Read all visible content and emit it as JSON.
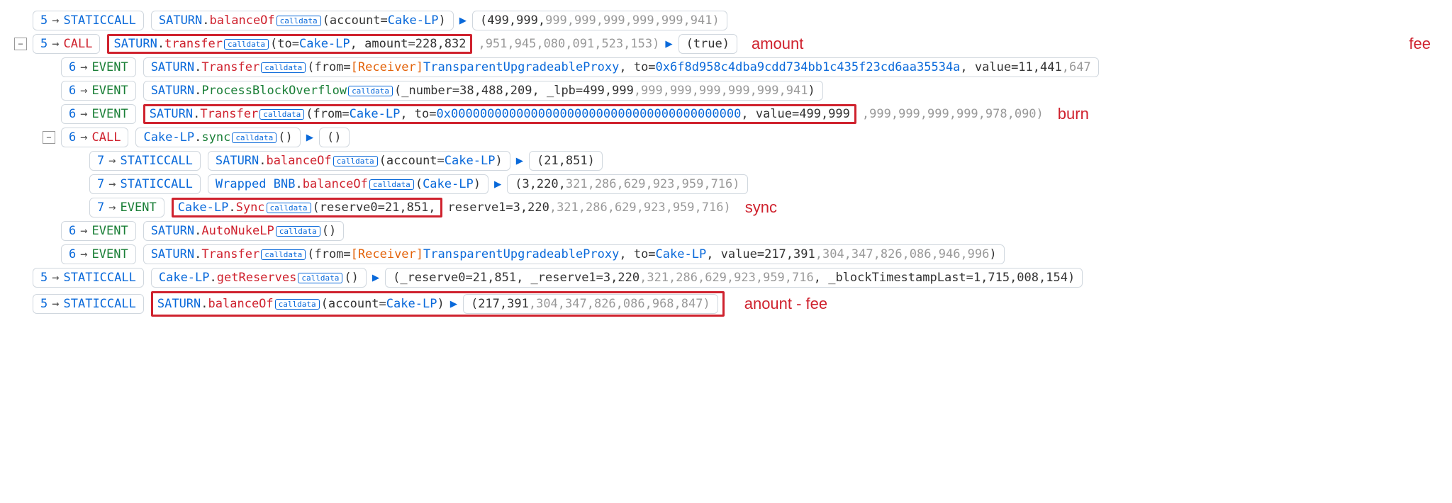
{
  "rows": [
    {
      "indent": 0,
      "toggle": null,
      "depth": "5",
      "type": "STATICCALL",
      "contract": "SATURN",
      "method": "balanceOf",
      "methodClass": "method-r",
      "args": [
        {
          "k": "account",
          "v": "Cake-LP",
          "cls": "val-blue"
        }
      ],
      "retDark": "(499,999,",
      "retLight": "999,999,999,999,999,941)",
      "ret": true
    },
    {
      "indent": 0,
      "toggle": "−",
      "depth": "5",
      "type": "CALL",
      "redbox": true,
      "contract": "SATURN",
      "method": "transfer",
      "methodClass": "method-r",
      "args": [
        {
          "k": "to",
          "v": "Cake-LP",
          "cls": "val-blue"
        },
        {
          "k": "amount",
          "v": "228,832",
          "cls": "num-dark"
        }
      ],
      "tailLight": ",951,945,080,091,523,153)",
      "retDark": "(true)",
      "ret": true,
      "ann": "amount",
      "annFar": "fee"
    },
    {
      "indent": 1,
      "toggle": null,
      "depth": "6",
      "type": "EVENT",
      "contract": "SATURN",
      "method": "Transfer",
      "methodClass": "method-r",
      "rawArgs": "(from=<o>[Receiver]</o><b>TransparentUpgradeableProxy</b>, to=<b>0x6f8d958c4dba9cdd734bb1c435f23cd6aa35534a</b>, value=11,441<l>,647</l>"
    },
    {
      "indent": 1,
      "toggle": null,
      "depth": "6",
      "type": "EVENT",
      "contract": "SATURN",
      "method": "ProcessBlockOverflow",
      "methodClass": "method-g",
      "rawArgs": "(_number=38,488,209, _lpb=499,999<l>,999,999,999,999,999,941</l>)"
    },
    {
      "indent": 1,
      "toggle": null,
      "depth": "6",
      "type": "EVENT",
      "redboxBody": true,
      "contract": "SATURN",
      "method": "Transfer",
      "methodClass": "method-r",
      "rawArgs": "(from=<b>Cake-LP</b>, to=<b>0x0000000000000000000000000000000000000000</b>, value=499,999",
      "tailLight": ",999,999,999,999,978,090)",
      "ann": "burn",
      "annShift": true
    },
    {
      "indent": 1,
      "toggle": "−",
      "depth": "6",
      "type": "CALL",
      "contract": "Cake-LP",
      "method": "sync",
      "methodClass": "method-g",
      "args": [],
      "retDark": "()",
      "ret": true
    },
    {
      "indent": 2,
      "toggle": null,
      "depth": "7",
      "type": "STATICCALL",
      "contract": "SATURN",
      "method": "balanceOf",
      "methodClass": "method-r",
      "args": [
        {
          "k": "account",
          "v": "Cake-LP",
          "cls": "val-blue"
        }
      ],
      "retDark": "(21,851)",
      "ret": true
    },
    {
      "indent": 2,
      "toggle": null,
      "depth": "7",
      "type": "STATICCALL",
      "contract": "Wrapped BNB",
      "method": "balanceOf",
      "methodClass": "method-r",
      "args": [
        {
          "k": null,
          "v": "Cake-LP",
          "cls": "val-blue"
        }
      ],
      "retDark": "(3,220,",
      "retLight": "321,286,629,923,959,716)",
      "ret": true
    },
    {
      "indent": 2,
      "toggle": null,
      "depth": "7",
      "type": "EVENT",
      "redboxBody": true,
      "contract": "Cake-LP",
      "method": "Sync",
      "methodClass": "method-r",
      "rawArgs": "(reserve0=21,851,",
      "tailDark": " reserve1=3,220",
      "tailLight": ",321,286,629,923,959,716)",
      "ann": "sync"
    },
    {
      "indent": 1,
      "toggle": null,
      "depth": "6",
      "type": "EVENT",
      "contract": "SATURN",
      "method": "AutoNukeLP",
      "methodClass": "method-r",
      "args": []
    },
    {
      "indent": 1,
      "toggle": null,
      "depth": "6",
      "type": "EVENT",
      "contract": "SATURN",
      "method": "Transfer",
      "methodClass": "method-r",
      "rawArgs": "(from=<o>[Receiver]</o><b>TransparentUpgradeableProxy</b>, to=<b>Cake-LP</b>, value=217,391<l>,304,347,826,086,946,996</l>)"
    },
    {
      "indent": 0,
      "toggle": null,
      "depth": "5",
      "type": "STATICCALL",
      "contract": "Cake-LP",
      "method": "getReserves",
      "methodClass": "method-r",
      "args": [],
      "retDark": "(_reserve0=21,851, _reserve1=3,220",
      "retLight": ",321,286,629,923,959,716",
      "retDark2": ", _blockTimestampLast=1,715,008,154)",
      "ret": true
    },
    {
      "indent": 0,
      "toggle": null,
      "depth": "5",
      "type": "STATICCALL",
      "redboxFull": true,
      "contract": "SATURN",
      "method": "balanceOf",
      "methodClass": "method-r",
      "args": [
        {
          "k": "account",
          "v": "Cake-LP",
          "cls": "val-blue"
        }
      ],
      "retDark": "(217,391",
      "retLight": ",304,347,826,086,968,847)",
      "ret": true,
      "ann": "anount - fee"
    }
  ],
  "labels": {
    "calldata": "calldata"
  }
}
